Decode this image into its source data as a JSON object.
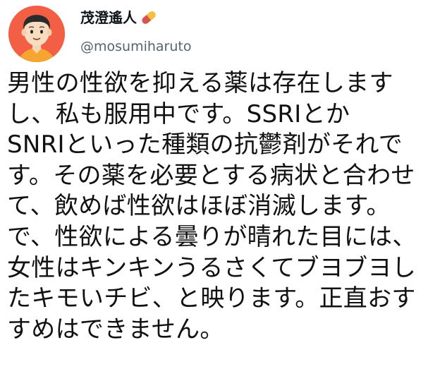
{
  "author": {
    "display_name": "茂澄遙人",
    "handle": "@mosumiharuto",
    "avatar_icon": "cartoon-avatar-icon",
    "name_emoji_icon": "pill-icon",
    "colors": {
      "avatar_bg": "#f25f45",
      "handle": "#536471"
    }
  },
  "tweet": {
    "lines": [
      "男性の性欲を抑える薬は存在します",
      "し、私も服用中です。SSRIとか",
      "SNRIといった種類の抗鬱剤がそれで",
      "す。その薬を必要とする病状と合わせ",
      "て、飲めば性欲はほぼ消滅します。",
      "で、性欲による曇りが晴れた目には、",
      "女性はキンキンうるさくてブヨブヨし",
      "たキモいチビ、と映ります。正直おす",
      "すめはできません。"
    ]
  }
}
